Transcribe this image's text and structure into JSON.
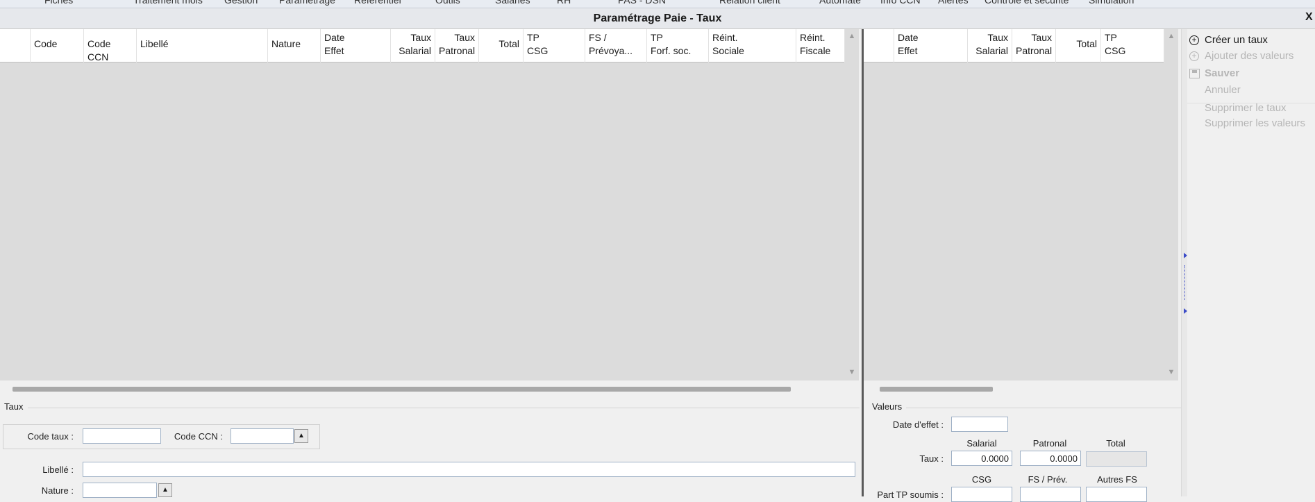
{
  "menu": {
    "items": [
      "Fiches",
      "Traitement mois",
      "Gestion",
      "Paramétrage",
      "Référentiel",
      "Outils",
      "Salariés",
      "RH",
      "PAS - DSN",
      "Relation client",
      "Automate",
      "Info CCN",
      "Alertes",
      "Contrôle et sécurité",
      "Simulation"
    ]
  },
  "window": {
    "title": "Paramétrage Paie - Taux",
    "close_label": "X"
  },
  "main_grid": {
    "columns": [
      {
        "l1": "",
        "l2": "Code"
      },
      {
        "l1": "",
        "l2": "Code CCN"
      },
      {
        "l1": "",
        "l2": "Libellé"
      },
      {
        "l1": "",
        "l2": "Nature"
      },
      {
        "l1": "Date",
        "l2": "Effet"
      },
      {
        "l1": "Taux",
        "l2": "Salarial"
      },
      {
        "l1": "Taux",
        "l2": "Patronal"
      },
      {
        "l1": "",
        "l2": "Total"
      },
      {
        "l1": "TP",
        "l2": "CSG"
      },
      {
        "l1": "FS /",
        "l2": "Prévoya..."
      },
      {
        "l1": "TP",
        "l2": "Forf. soc."
      },
      {
        "l1": "Réint.",
        "l2": "Sociale"
      },
      {
        "l1": "Réint.",
        "l2": "Fiscale"
      }
    ]
  },
  "values_grid": {
    "columns": [
      {
        "l1": "Date",
        "l2": "Effet"
      },
      {
        "l1": "Taux",
        "l2": "Salarial"
      },
      {
        "l1": "Taux",
        "l2": "Patronal"
      },
      {
        "l1": "",
        "l2": "Total"
      },
      {
        "l1": "TP",
        "l2": "CSG"
      }
    ]
  },
  "actions": {
    "create": "Créer un taux",
    "add_values": "Ajouter des valeurs",
    "save": "Sauver",
    "cancel": "Annuler",
    "delete_rate": "Supprimer le taux",
    "delete_values": "Supprimer les valeurs"
  },
  "taux_form": {
    "section": "Taux",
    "code_taux_label": "Code taux :",
    "code_taux_value": "",
    "code_ccn_label": "Code CCN :",
    "code_ccn_value": "",
    "libelle_label": "Libellé :",
    "libelle_value": "",
    "nature_label": "Nature :",
    "nature_value": ""
  },
  "valeurs_form": {
    "section": "Valeurs",
    "date_effet_label": "Date d'effet :",
    "date_effet_value": "",
    "col_salarial": "Salarial",
    "col_patronal": "Patronal",
    "col_total": "Total",
    "taux_label": "Taux :",
    "taux_salarial": "0.0000",
    "taux_patronal": "0.0000",
    "taux_total": "",
    "col_csg": "CSG",
    "col_fs_prev": "FS / Prév.",
    "col_autres_fs": "Autres FS",
    "part_tp_label": "Part TP soumis :"
  }
}
